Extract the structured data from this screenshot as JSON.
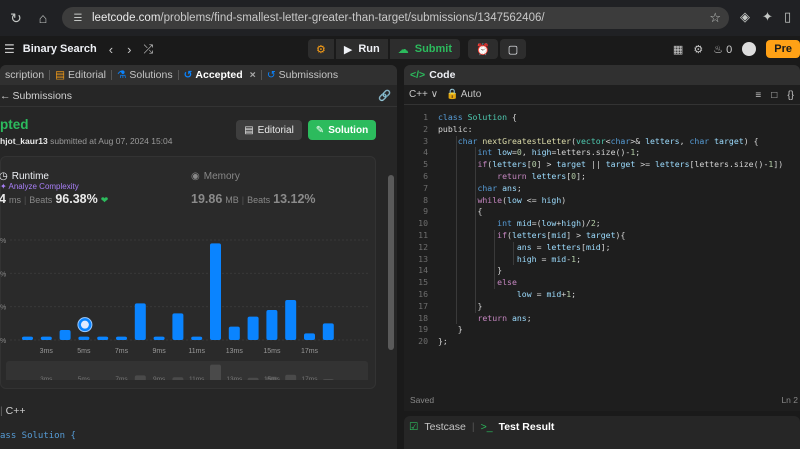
{
  "browser": {
    "url_host": "leetcode.com",
    "url_path": "/problems/find-smallest-letter-greater-than-target/submissions/1347562406/"
  },
  "topbar": {
    "problem_list": "Binary Search",
    "run_label": "Run",
    "submit_label": "Submit",
    "fire_count": "0",
    "premium_label": "Pre"
  },
  "left": {
    "tabs": [
      "scription",
      "Editorial",
      "Solutions",
      "Accepted",
      "Submissions"
    ],
    "sub_header": "Submissions",
    "status": "pted",
    "submitter": "hjot_kaur13",
    "submitted_text": "submitted at Aug 07, 2024 15:04",
    "editorial_btn": "Editorial",
    "solution_btn": "Solution",
    "runtime_label": "Runtime",
    "runtime_value": "4",
    "runtime_unit": "ms",
    "runtime_beats_label": "Beats",
    "runtime_beats": "96.38%",
    "memory_label": "Memory",
    "memory_value": "19.86",
    "memory_unit": "MB",
    "memory_beats_label": "Beats",
    "memory_beats": "13.12%",
    "analyze": "Analyze Complexity",
    "language": "C++",
    "code_peek": "ass Solution {"
  },
  "chart_data": {
    "type": "bar",
    "ytick_labels": [
      "%",
      "%",
      "%",
      "%"
    ],
    "xtick_labels": [
      "3ms",
      "5ms",
      "7ms",
      "9ms",
      "11ms",
      "13ms",
      "15ms",
      "17ms"
    ],
    "values": [
      1,
      1,
      3,
      1,
      1,
      1,
      11,
      1,
      8,
      1,
      29,
      4,
      7,
      9,
      12,
      2,
      5
    ],
    "highlight_index": 3,
    "color": "#0a84ff"
  },
  "right": {
    "title": "Code",
    "language": "C++",
    "mode": "Auto",
    "code_lines": [
      "class Solution {",
      "public:",
      "    char nextGreatestLetter(vector<char>& letters, char target) {",
      "        int low=0, high=letters.size()-1;",
      "        if(letters[0] > target || target >= letters[letters.size()-1])",
      "            return letters[0];",
      "        char ans;",
      "        while(low <= high)",
      "        {",
      "            int mid=(low+high)/2;",
      "            if(letters[mid] > target){",
      "                ans = letters[mid];",
      "                high = mid-1;",
      "            }",
      "            else",
      "                low = mid+1;",
      "        }",
      "        return ans;",
      "    }",
      "};"
    ],
    "saved": "Saved",
    "cursor_pos": "Ln 2",
    "bottom_tabs": [
      "Testcase",
      "Test Result"
    ]
  }
}
